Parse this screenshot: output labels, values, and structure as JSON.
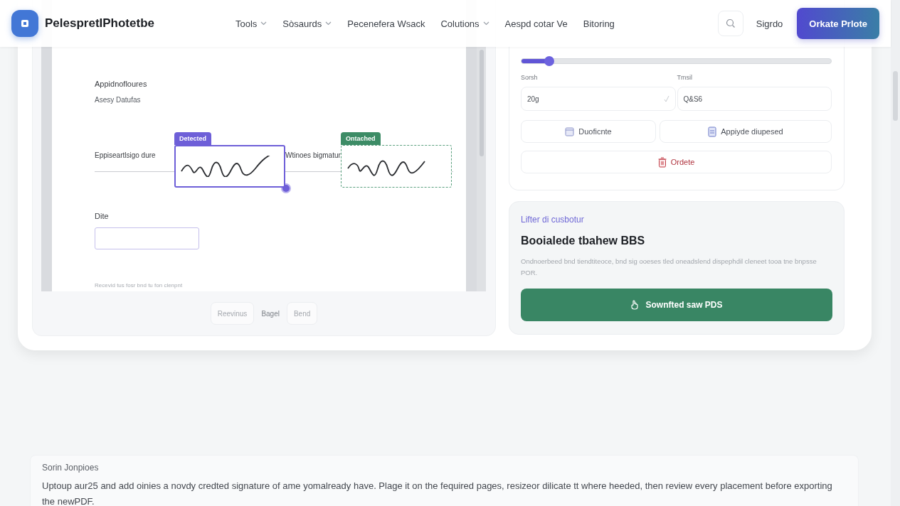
{
  "nav": {
    "logo_text": "PelespretIPhotetbe",
    "items": [
      {
        "label": "Tools",
        "has_menu": true
      },
      {
        "label": "Sòsaurds",
        "has_menu": true
      },
      {
        "label": "Pecenefera Wsack",
        "has_menu": false
      },
      {
        "label": "Colutions",
        "has_menu": true
      },
      {
        "label": "Aespd cotar Ve",
        "has_menu": false
      },
      {
        "label": "Bitoring",
        "has_menu": false
      }
    ],
    "sign_in": "Sigrdo",
    "cta": "Orkate Prlote"
  },
  "document": {
    "heading": "Appidnofloures",
    "subheading": "Asesy Datufas",
    "signatures": [
      {
        "label": "Eppiseartlsigo dure",
        "badge": "Detected",
        "selected": true
      },
      {
        "label": "Wtinoes bigmatur",
        "badge": "Ontached",
        "selected": false
      }
    ],
    "date_label": "Dite",
    "footnote": "Recevid tus fosr bnd tu fon clenpnt"
  },
  "pagination": [
    {
      "label": "Reevinus",
      "kind": "button"
    },
    {
      "label": "Bagel",
      "kind": "text"
    },
    {
      "label": "Bend",
      "kind": "button"
    }
  ],
  "settings": {
    "level": 0.09,
    "fields": [
      {
        "label": "Sorsh",
        "value": "20g",
        "checked": true
      },
      {
        "label": "Tmsil",
        "value": "Q&S6",
        "checked": false
      }
    ],
    "actions": [
      {
        "label": "Duoficnte",
        "kind": "copy"
      },
      {
        "label": "Appiyde diupesed",
        "kind": "file"
      },
      {
        "label": "Ordete",
        "kind": "delete"
      }
    ]
  },
  "download": {
    "eyebrow": "Lifter di cusbotur",
    "title": "Booialede tbahew BBS",
    "description": "Ondnoerbeed bnd tiendtiteoce, bnd sig ooeses tled oneadslend dispephdil cleneet tooa tne bnpsse POR.",
    "button": "Sownfted saw PDS"
  },
  "info": {
    "title": "Sorin Jonpioes",
    "text": "Uptoup aur25 and add oinies a novdy credted signature of ame yomalready have. Plage it on the fequired pages, resizeor dilicate tt where heeded, then review every placement before exporting the newPDF."
  }
}
